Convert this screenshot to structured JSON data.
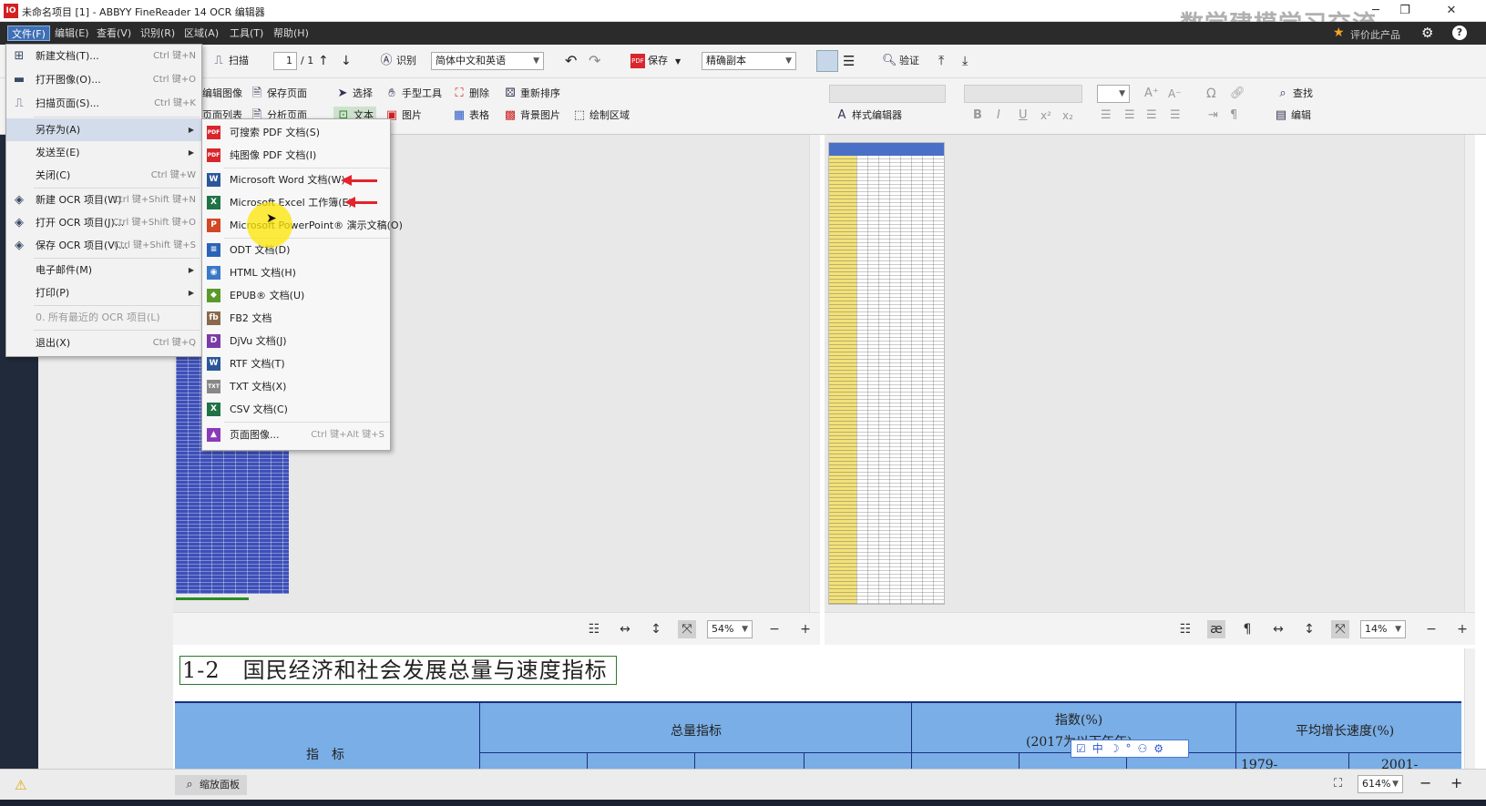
{
  "window": {
    "title": "未命名项目 [1] - ABBYY FineReader 14 OCR 编辑器",
    "logo_text": "IO",
    "watermark": "数学建模学习交流",
    "feedback": "评价此产品",
    "minimize": "─",
    "restore": "❐",
    "close": "✕"
  },
  "menubar": {
    "items": [
      "文件(F)",
      "编辑(E)",
      "查看(V)",
      "识别(R)",
      "区域(A)",
      "工具(T)",
      "帮助(H)"
    ]
  },
  "toolbar1": {
    "scan": "扫描",
    "page_value": "1",
    "page_total": "/ 1",
    "recognize": "识别",
    "language": "简体中文和英语",
    "save": "保存",
    "save_mode": "精确副本",
    "verify": "验证"
  },
  "toolbar2": {
    "edit_image": "编辑图像",
    "save_page": "保存页面",
    "select": "选择",
    "hand_tool": "手型工具",
    "delete": "删除",
    "reorder": "重新排序",
    "page_list": "页面列表",
    "analyze_page": "分析页面",
    "text": "文本",
    "picture": "图片",
    "table": "表格",
    "background_picture": "背景图片",
    "draw_area": "绘制区域",
    "style_editor": "样式编辑器",
    "find": "查找",
    "edit": "编辑"
  },
  "file_menu": {
    "items": [
      {
        "label": "新建文档(T)...",
        "shortcut": "Ctrl 键+N",
        "icon": "new-doc-icon"
      },
      {
        "label": "打开图像(O)...",
        "shortcut": "Ctrl 键+O",
        "icon": "folder-icon"
      },
      {
        "label": "扫描页面(S)...",
        "shortcut": "Ctrl 键+K",
        "icon": "scanner-icon"
      },
      {
        "label": "另存为(A)",
        "shortcut": "",
        "icon": "",
        "submenu": true
      },
      {
        "label": "发送至(E)",
        "shortcut": "",
        "icon": "",
        "submenu": true
      },
      {
        "label": "关闭(C)",
        "shortcut": "Ctrl 键+W",
        "icon": ""
      },
      {
        "label": "新建 OCR 项目(W)",
        "shortcut": "Ctrl 键+Shift 键+N",
        "icon": "ocr-new-icon"
      },
      {
        "label": "打开 OCR 项目(J)...",
        "shortcut": "Ctrl 键+Shift 键+O",
        "icon": "ocr-open-icon"
      },
      {
        "label": "保存 OCR 项目(V)...",
        "shortcut": "Ctrl 键+Shift 键+S",
        "icon": "ocr-save-icon"
      },
      {
        "label": "电子邮件(M)",
        "shortcut": "",
        "icon": "",
        "submenu": true
      },
      {
        "label": "打印(P)",
        "shortcut": "",
        "icon": "",
        "submenu": true
      },
      {
        "label": "0. 所有最近的 OCR 项目(L)",
        "shortcut": "",
        "icon": "",
        "disabled": true
      },
      {
        "label": "退出(X)",
        "shortcut": "Ctrl 键+Q",
        "icon": ""
      }
    ]
  },
  "saveas_menu": {
    "items": [
      {
        "label": "可搜索 PDF 文档(S)",
        "icon": "PDF",
        "color": "#d9262d",
        "shortcut": ""
      },
      {
        "label": "纯图像 PDF 文档(I)",
        "icon": "PDF",
        "color": "#d9262d",
        "shortcut": ""
      },
      {
        "label": "Microsoft Word 文档(W)",
        "icon": "W",
        "color": "#2b579a",
        "shortcut": ""
      },
      {
        "label": "Microsoft Excel 工作簿(E)",
        "icon": "X",
        "color": "#217346",
        "shortcut": ""
      },
      {
        "label": "Microsoft PowerPoint® 演示文稿(O)",
        "icon": "P",
        "color": "#d24726",
        "shortcut": ""
      },
      {
        "label": "ODT 文档(D)",
        "icon": "≡",
        "color": "#2a63b8",
        "shortcut": ""
      },
      {
        "label": "HTML 文档(H)",
        "icon": "◉",
        "color": "#3a78c8",
        "shortcut": ""
      },
      {
        "label": "EPUB® 文档(U)",
        "icon": "◆",
        "color": "#5a9a2a",
        "shortcut": ""
      },
      {
        "label": "FB2 文档",
        "icon": "fb",
        "color": "#8a6a4a",
        "shortcut": ""
      },
      {
        "label": "DjVu 文档(J)",
        "icon": "D",
        "color": "#7a3aa8",
        "shortcut": ""
      },
      {
        "label": "RTF 文档(T)",
        "icon": "W",
        "color": "#2b579a",
        "shortcut": ""
      },
      {
        "label": "TXT 文档(X)",
        "icon": "TXT",
        "color": "#888888",
        "shortcut": ""
      },
      {
        "label": "CSV 文档(C)",
        "icon": "X",
        "color": "#217346",
        "shortcut": ""
      },
      {
        "label": "页面图像...",
        "icon": "▲",
        "color": "#8a3ab8",
        "shortcut": "Ctrl 键+Alt 键+S"
      }
    ]
  },
  "image_view": {
    "zoom": "54%"
  },
  "text_view": {
    "zoom": "14%"
  },
  "zoom_view": {
    "heading": "1-2　国民经济和社会发展总量与速度指标",
    "col_indicator": "指　标",
    "col_total": "总量指标",
    "col_index": "指数(%)",
    "col_index_sub": "(2017为以下年年)",
    "col_growth": "平均增长速度(%)",
    "col_1979": "1979-",
    "col_2001": "2001-",
    "zoom": "614%"
  },
  "status": {
    "zoom_panel": "缩放面板",
    "warning_icon": "⚠"
  },
  "colors": {
    "accent": "#3f6fb5",
    "arrow": "#e3242b",
    "table_blue": "#7aaee6"
  }
}
